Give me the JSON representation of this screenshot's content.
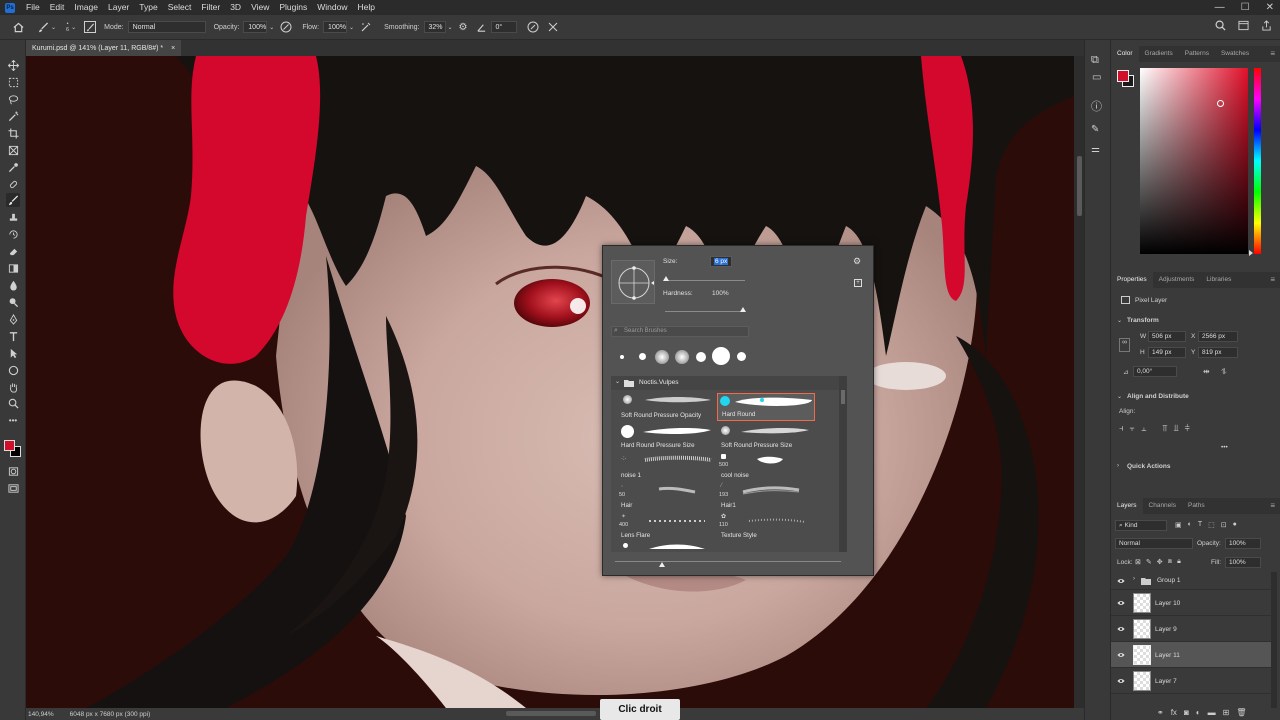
{
  "menubar": {
    "logo": "Ps",
    "items": [
      "File",
      "Edit",
      "Image",
      "Layer",
      "Type",
      "Select",
      "Filter",
      "3D",
      "View",
      "Plugins",
      "Window",
      "Help"
    ]
  },
  "options": {
    "brush_size": "6",
    "mode_label": "Mode:",
    "mode_value": "Normal",
    "opacity_label": "Opacity:",
    "opacity_value": "100%",
    "flow_label": "Flow:",
    "flow_value": "100%",
    "smoothing_label": "Smoothing:",
    "smoothing_value": "32%",
    "angle_value": "0°"
  },
  "document": {
    "tab_title": "Kurumi.psd @ 141% (Layer 11, RGB/8#) *",
    "close": "×"
  },
  "status": {
    "zoom": "140,94%",
    "doc_size": "6048 px x 7680 px (300 ppi)",
    "overlay_caption": "Clic droit"
  },
  "brush_popup": {
    "size_label": "Size:",
    "size_value": "6 px",
    "hardness_label": "Hardness:",
    "hardness_value": "100%",
    "search_placeholder": "Search Brushes",
    "folder_name": "Noctis.Vulpes",
    "brushes": [
      {
        "name": "Soft Round Pressure Opacity",
        "number": ""
      },
      {
        "name": "Hard Round",
        "number": ""
      },
      {
        "name": "Hard Round Pressure Size",
        "number": ""
      },
      {
        "name": "Soft Round Pressure Size",
        "number": ""
      },
      {
        "name": "noise 1",
        "number": ""
      },
      {
        "name": "cool noise",
        "number": "500"
      },
      {
        "name": "Hair",
        "number": "50"
      },
      {
        "name": "Hair1",
        "number": "193"
      },
      {
        "name": "Lens Flare",
        "number": "400"
      },
      {
        "name": "Texture Style",
        "number": "110"
      }
    ]
  },
  "color_panel": {
    "tabs": [
      "Color",
      "Gradients",
      "Patterns",
      "Swatches"
    ],
    "foreground": "#d0102a"
  },
  "properties": {
    "tabs": [
      "Properties",
      "Adjustments",
      "Libraries"
    ],
    "layer_type": "Pixel Layer",
    "transform_label": "Transform",
    "w_label": "W",
    "w_value": "506 px",
    "x_label": "X",
    "x_value": "2566 px",
    "h_label": "H",
    "h_value": "149 px",
    "y_label": "Y",
    "y_value": "819 px",
    "angle": "0,00°",
    "align_label": "Align and Distribute",
    "align_sub": "Align:",
    "more": "•••",
    "quick_actions": "Quick Actions"
  },
  "layers": {
    "tabs": [
      "Layers",
      "Channels",
      "Paths"
    ],
    "kind": "Kind",
    "blend": "Normal",
    "opacity_label": "Opacity:",
    "opacity_value": "100%",
    "lock_label": "Lock:",
    "fill_label": "Fill:",
    "fill_value": "100%",
    "rows": [
      "Group 1",
      "Layer 10",
      "Layer 9",
      "Layer 11",
      "Layer 7"
    ],
    "selected": "Layer 11"
  }
}
